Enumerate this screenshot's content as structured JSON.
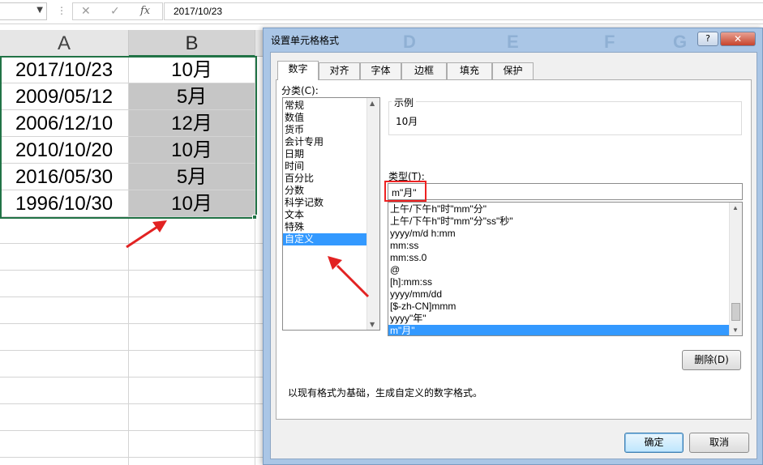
{
  "formula_bar": {
    "cancel_icon": "✕",
    "enter_icon": "✓",
    "fx_icon": "fx",
    "value": "2017/10/23"
  },
  "sheet": {
    "columns": [
      "A",
      "B"
    ],
    "col_a": [
      "2017/10/23",
      "2009/05/12",
      "2006/12/10",
      "2010/10/20",
      "2016/05/30",
      "1996/10/30"
    ],
    "col_b": [
      "10月",
      "5月",
      "12月",
      "10月",
      "5月",
      "10月"
    ]
  },
  "dialog": {
    "title": "设置单元格格式",
    "ghost_letters": [
      "D",
      "E",
      "F",
      "G"
    ],
    "help": "?",
    "close": "✕",
    "tabs": [
      "数字",
      "对齐",
      "字体",
      "边框",
      "填充",
      "保护"
    ],
    "category_label": "分类(C):",
    "categories": [
      "常规",
      "数值",
      "货币",
      "会计专用",
      "日期",
      "时间",
      "百分比",
      "分数",
      "科学记数",
      "文本",
      "特殊",
      "自定义"
    ],
    "sample_label": "示例",
    "sample_value": "10月",
    "type_label": "类型(T):",
    "type_value": "m\"月\"",
    "formats": [
      "上午/下午h\"时\"mm\"分\"",
      "上午/下午h\"时\"mm\"分\"ss\"秒\"",
      "yyyy/m/d h:mm",
      "mm:ss",
      "mm:ss.0",
      "@",
      "[h]:mm:ss",
      "yyyy/mm/dd",
      "[$-zh-CN]mmm",
      "yyyy\"年\"",
      "m\"月\""
    ],
    "delete_button": "删除(D)",
    "description": "以现有格式为基础，生成自定义的数字格式。",
    "ok_button": "确定",
    "cancel_button": "取消"
  },
  "colors": {
    "excel_green": "#217346",
    "selection_blue": "#3399ff",
    "annotation_red": "#e22222",
    "dialog_frame": "#aac6e6"
  }
}
